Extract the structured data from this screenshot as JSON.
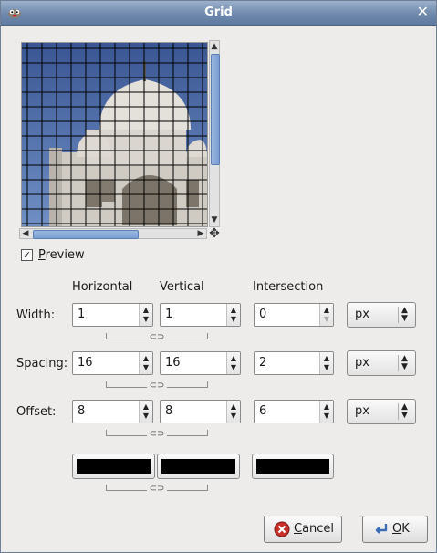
{
  "window": {
    "title": "Grid",
    "close_icon": "close-icon",
    "app_icon": "gimp-icon"
  },
  "preview": {
    "checkbox_checked": true,
    "label_mnemonic": "P",
    "label_rest": "review"
  },
  "columns": {
    "horizontal": "Horizontal",
    "vertical": "Vertical",
    "intersection": "Intersection"
  },
  "rows": [
    {
      "label": "Width:",
      "horizontal": "1",
      "vertical": "1",
      "intersection": "0",
      "unit": "px"
    },
    {
      "label": "Spacing:",
      "horizontal": "16",
      "vertical": "16",
      "intersection": "2",
      "unit": "px"
    },
    {
      "label": "Offset:",
      "horizontal": "8",
      "vertical": "8",
      "intersection": "6",
      "unit": "px"
    }
  ],
  "colors": {
    "horizontal": "#000000",
    "vertical": "#000000",
    "intersection": "#000000"
  },
  "buttons": {
    "cancel_mnemonic": "C",
    "cancel_rest": "ancel",
    "ok_mnemonic": "O",
    "ok_rest": "K"
  }
}
